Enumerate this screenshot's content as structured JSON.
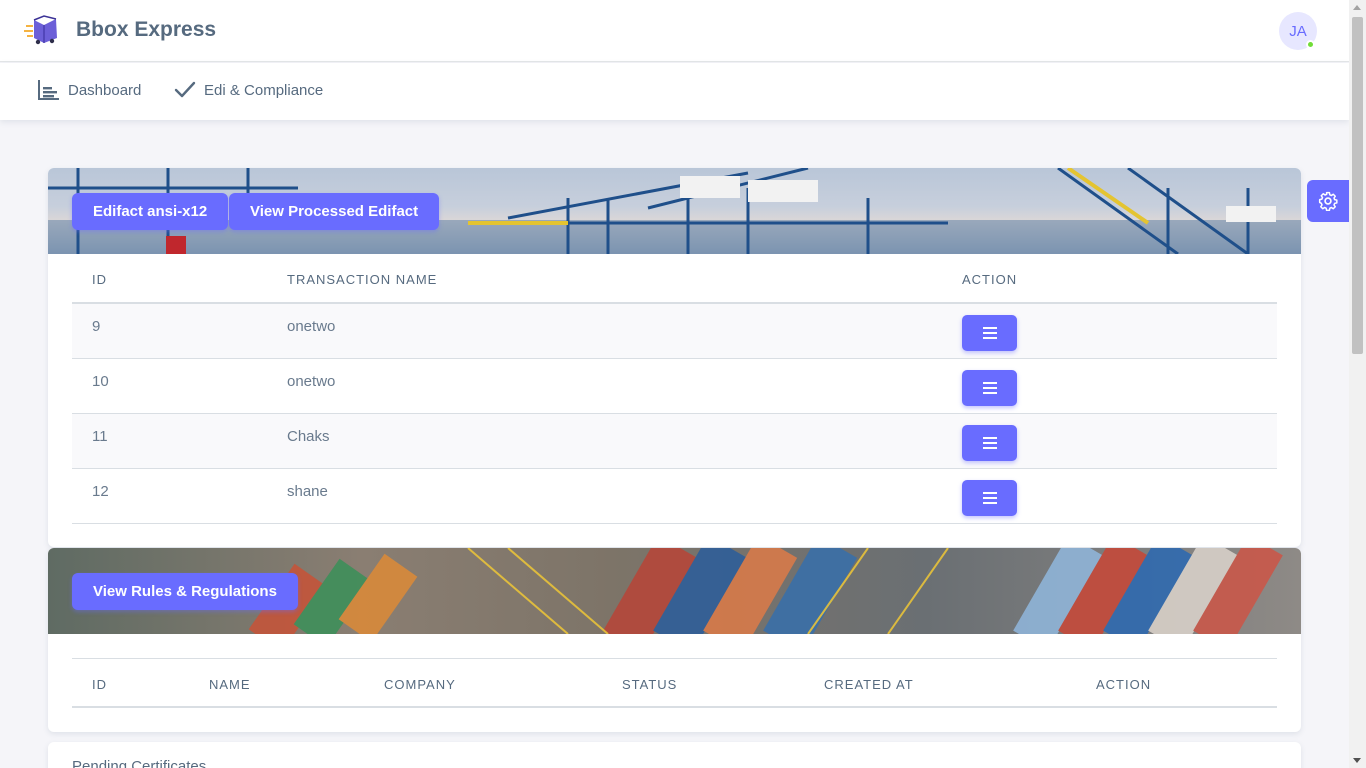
{
  "header": {
    "brand_name": "Bbox Express",
    "avatar_initials": "JA",
    "status_color": "#71dd37"
  },
  "menu": {
    "items": [
      {
        "label": "Dashboard",
        "icon": "bar-chart-icon"
      },
      {
        "label": "Edi & Compliance",
        "icon": "check-icon"
      }
    ]
  },
  "edifact_card": {
    "buttons": {
      "edifact": "Edifact ansi-x12",
      "view_processed": "View Processed Edifact"
    },
    "columns": [
      "ID",
      "TRANSACTION NAME",
      "ACTION"
    ],
    "rows": [
      {
        "id": "9",
        "name": "onetwo"
      },
      {
        "id": "10",
        "name": "onetwo"
      },
      {
        "id": "11",
        "name": "Chaks"
      },
      {
        "id": "12",
        "name": "shane"
      }
    ]
  },
  "rules_card": {
    "button": "View Rules & Regulations",
    "columns": [
      "ID",
      "NAME",
      "COMPANY",
      "STATUS",
      "CREATED AT",
      "ACTION"
    ]
  },
  "pending_card": {
    "title": "Pending Certificates"
  },
  "theme": {
    "accent": "#696cff"
  }
}
